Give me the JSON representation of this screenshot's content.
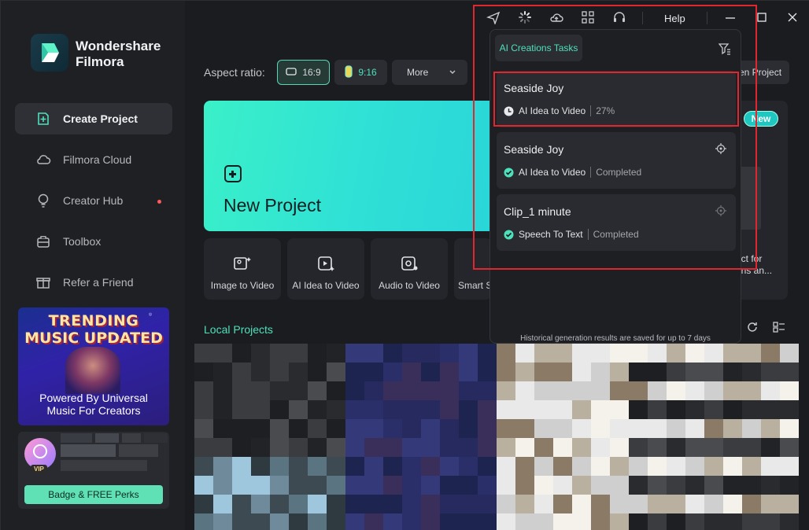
{
  "app": {
    "brand_line1": "Wondershare",
    "brand_line2": "Filmora"
  },
  "sidebar": {
    "items": [
      {
        "label": "Create Project",
        "icon": "plus-square-icon",
        "active": true
      },
      {
        "label": "Filmora Cloud",
        "icon": "cloud-icon"
      },
      {
        "label": "Creator Hub",
        "icon": "lightbulb-icon",
        "has_dot": true
      },
      {
        "label": "Toolbox",
        "icon": "toolbox-icon"
      },
      {
        "label": "Refer a Friend",
        "icon": "gift-icon"
      }
    ],
    "promo": {
      "line1": "TRENDING",
      "line2": "MUSIC UPDATED",
      "line3": "Powered By Universal",
      "line4": "Music For Creators"
    },
    "vip": {
      "badge": "VIP",
      "button_label": "Badge & FREE Perks"
    }
  },
  "main": {
    "aspect_label": "Aspect ratio:",
    "aspect_options": [
      {
        "label": "16:9",
        "selected": true
      },
      {
        "label": "9:16"
      },
      {
        "label": "More"
      }
    ],
    "open_project_label": "en Project",
    "new_project_label": "New Project",
    "new_tag": "New",
    "right_card_text_line1": "ect for",
    "right_card_text_line2": "ens an...",
    "tools": [
      {
        "label": "Image to Video",
        "icon": "image-to-video-icon"
      },
      {
        "label": "AI Idea to Video",
        "icon": "ai-idea-to-video-icon"
      },
      {
        "label": "Audio to Video",
        "icon": "audio-to-video-icon"
      },
      {
        "label": "Smart S",
        "icon": "smart-tool-icon"
      }
    ],
    "local_projects_title": "Local Projects"
  },
  "titlebar": {
    "help": "Help"
  },
  "popup": {
    "tab_label": "AI Creations Tasks",
    "tasks": [
      {
        "name": "Seaside Joy",
        "type": "AI Idea to Video",
        "status": "27%",
        "state": "in-progress"
      },
      {
        "name": "Seaside Joy",
        "type": "AI Idea to Video",
        "status": "Completed",
        "state": "completed"
      },
      {
        "name": "Clip_1 minute",
        "type": "Speech To Text",
        "status": "Completed",
        "state": "completed"
      }
    ],
    "footer": "Historical generation results are saved for up to 7 days"
  },
  "colors": {
    "accent": "#4ee0bb",
    "highlight": "#e0272f",
    "sidebar_bg": "#1f2024"
  }
}
